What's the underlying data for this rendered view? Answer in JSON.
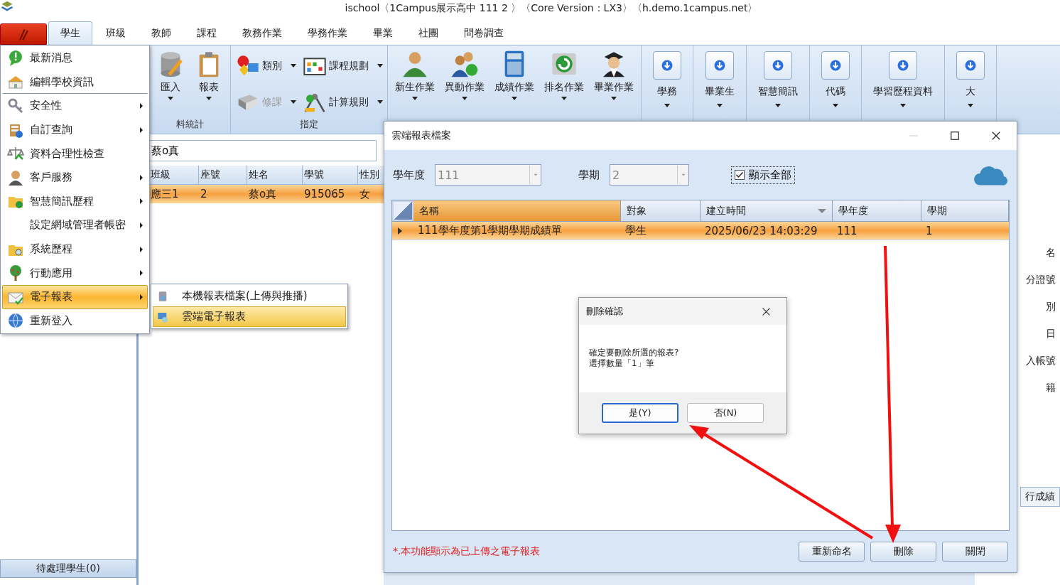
{
  "window": {
    "title": "ischool〈1Campus展示高中 111 2 〉〈Core Version：LX3〉〈h.demo.1campus.net〉"
  },
  "ribbon_tabs": [
    {
      "label": "學生",
      "selected": true
    },
    {
      "label": "班級",
      "selected": false
    },
    {
      "label": "教師",
      "selected": false
    },
    {
      "label": "課程",
      "selected": false
    },
    {
      "label": "教務作業",
      "selected": false
    },
    {
      "label": "學務作業",
      "selected": false
    },
    {
      "label": "畢業",
      "selected": false
    },
    {
      "label": "社團",
      "selected": false
    },
    {
      "label": "問卷調查",
      "selected": false
    }
  ],
  "ribbon_groups": [
    {
      "kind": "large",
      "label": "料統計",
      "items": [
        {
          "label": "匯入",
          "disabled": false
        },
        {
          "label": "報表",
          "disabled": false
        }
      ]
    },
    {
      "kind": "small",
      "label": "指定",
      "items": [
        {
          "label": "類別",
          "disabled": false
        },
        {
          "label": "課程規劃",
          "disabled": false
        },
        {
          "label": "修課",
          "disabled": true
        },
        {
          "label": "計算規則",
          "disabled": false
        }
      ]
    },
    {
      "kind": "large",
      "items": [
        {
          "label": "新生作業",
          "disabled": false
        },
        {
          "label": "異動作業",
          "disabled": false
        },
        {
          "label": "成績作業",
          "disabled": false
        },
        {
          "label": "排名作業",
          "disabled": false
        },
        {
          "label": "畢業作業",
          "disabled": false
        }
      ]
    },
    {
      "kind": "boxed",
      "items": [
        {
          "label": "學務",
          "disabled": false
        }
      ]
    },
    {
      "kind": "boxed",
      "items": [
        {
          "label": "畢業生",
          "disabled": false
        }
      ]
    },
    {
      "kind": "boxed",
      "items": [
        {
          "label": "智慧簡訊",
          "disabled": false
        }
      ]
    },
    {
      "kind": "boxed",
      "items": [
        {
          "label": "代碼",
          "disabled": false
        }
      ]
    },
    {
      "kind": "boxed",
      "items": [
        {
          "label": "學習歷程資料",
          "disabled": false
        }
      ]
    },
    {
      "kind": "boxed",
      "items": [
        {
          "label": "大",
          "disabled": false
        }
      ]
    }
  ],
  "app_menu": {
    "items": [
      {
        "label": "最新消息",
        "submenu": false,
        "selected": false,
        "divider_after": false
      },
      {
        "label": "編輯學校資訊",
        "submenu": false,
        "selected": false,
        "divider_after": true
      },
      {
        "label": "安全性",
        "submenu": true,
        "selected": false,
        "divider_after": false
      },
      {
        "label": "自訂查詢",
        "submenu": true,
        "selected": false,
        "divider_after": false
      },
      {
        "label": "資料合理性檢查",
        "submenu": false,
        "selected": false,
        "divider_after": false
      },
      {
        "label": "客戶服務",
        "submenu": true,
        "selected": false,
        "divider_after": false
      },
      {
        "label": "智慧簡訊歷程",
        "submenu": true,
        "selected": false,
        "divider_after": false
      },
      {
        "label": "設定網域管理者帳密",
        "submenu": true,
        "selected": false,
        "divider_after": false
      },
      {
        "label": "系統歷程",
        "submenu": true,
        "selected": false,
        "divider_after": false
      },
      {
        "label": "行動應用",
        "submenu": true,
        "selected": false,
        "divider_after": false
      },
      {
        "label": "電子報表",
        "submenu": true,
        "selected": true,
        "divider_after": false
      },
      {
        "label": "重新登入",
        "submenu": false,
        "selected": false,
        "divider_after": false
      }
    ],
    "submenu": [
      {
        "label": "本機報表檔案(上傳與推播)",
        "selected": false
      },
      {
        "label": "雲端電子報表",
        "selected": true
      }
    ]
  },
  "left_panel": {
    "pending_button": "待處理學生(0)"
  },
  "student_list": {
    "search": {
      "value": "蔡o真"
    },
    "columns": [
      "班級",
      "座號",
      "姓名",
      "學號",
      "性別"
    ],
    "rows": [
      {
        "cells": [
          "應三1",
          "2",
          "蔡o真",
          "915065",
          "女"
        ],
        "selected": true
      }
    ]
  },
  "detail_panel": {
    "labels": [
      "名",
      "分證號",
      "別",
      "日",
      "入帳號",
      "籍"
    ],
    "tab": "行成績"
  },
  "cloud_dialog": {
    "title": "雲端報表檔案",
    "school_year": {
      "label": "學年度",
      "value": "111",
      "disabled": true
    },
    "semester": {
      "label": "學期",
      "value": "2",
      "disabled": true
    },
    "show_all": {
      "label": "顯示全部",
      "checked": true
    },
    "columns": [
      {
        "label": "名稱",
        "selected": true,
        "sorted": false
      },
      {
        "label": "對象",
        "selected": false,
        "sorted": false
      },
      {
        "label": "建立時間",
        "selected": false,
        "sorted": true
      },
      {
        "label": "學年度",
        "selected": false,
        "sorted": false
      },
      {
        "label": "學期",
        "selected": false,
        "sorted": false
      }
    ],
    "rows": [
      {
        "cells": [
          "111學年度第1學期學期成績單",
          "學生",
          "2025/06/23 14:03:29",
          "111",
          "1"
        ],
        "selected": true
      }
    ],
    "note": "*.本功能顯示為已上傳之電子報表",
    "buttons": [
      "重新命名",
      "刪除",
      "關閉"
    ]
  },
  "confirm_dialog": {
    "title": "刪除確認",
    "message": "確定要刪除所選的報表?\n選擇數量「1」筆",
    "buttons": [
      {
        "label": "是(Y)",
        "focused": true
      },
      {
        "label": "否(N)",
        "focused": false
      }
    ]
  }
}
